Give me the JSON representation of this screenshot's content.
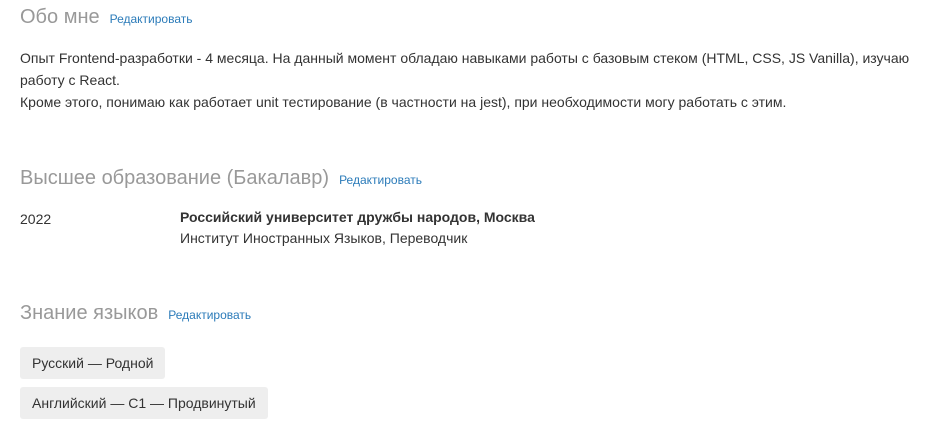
{
  "about": {
    "title": "Обо мне",
    "edit_label": "Редактировать",
    "paragraph_1": "Опыт Frontend-разработки - 4 месяца. На данный момент обладаю навыками работы с базовым стеком (HTML, CSS, JS Vanilla), изучаю работу с React.",
    "paragraph_2": "Кроме этого, понимаю как работает unit тестирование (в частности на jest), при необходимости могу работать с этим."
  },
  "education": {
    "title": "Высшее образование (Бакалавр)",
    "edit_label": "Редактировать",
    "items": [
      {
        "year": "2022",
        "university": "Российский университет дружбы народов, Москва",
        "faculty": "Институт Иностранных Языков, Переводчик"
      }
    ]
  },
  "languages": {
    "title": "Знание языков",
    "edit_label": "Редактировать",
    "items": [
      "Русский — Родной",
      "Английский — C1 — Продвинутый"
    ]
  },
  "colors": {
    "heading": "#999999",
    "link": "#2b7bb9",
    "text": "#333333",
    "chip_bg": "#eeeeee"
  }
}
